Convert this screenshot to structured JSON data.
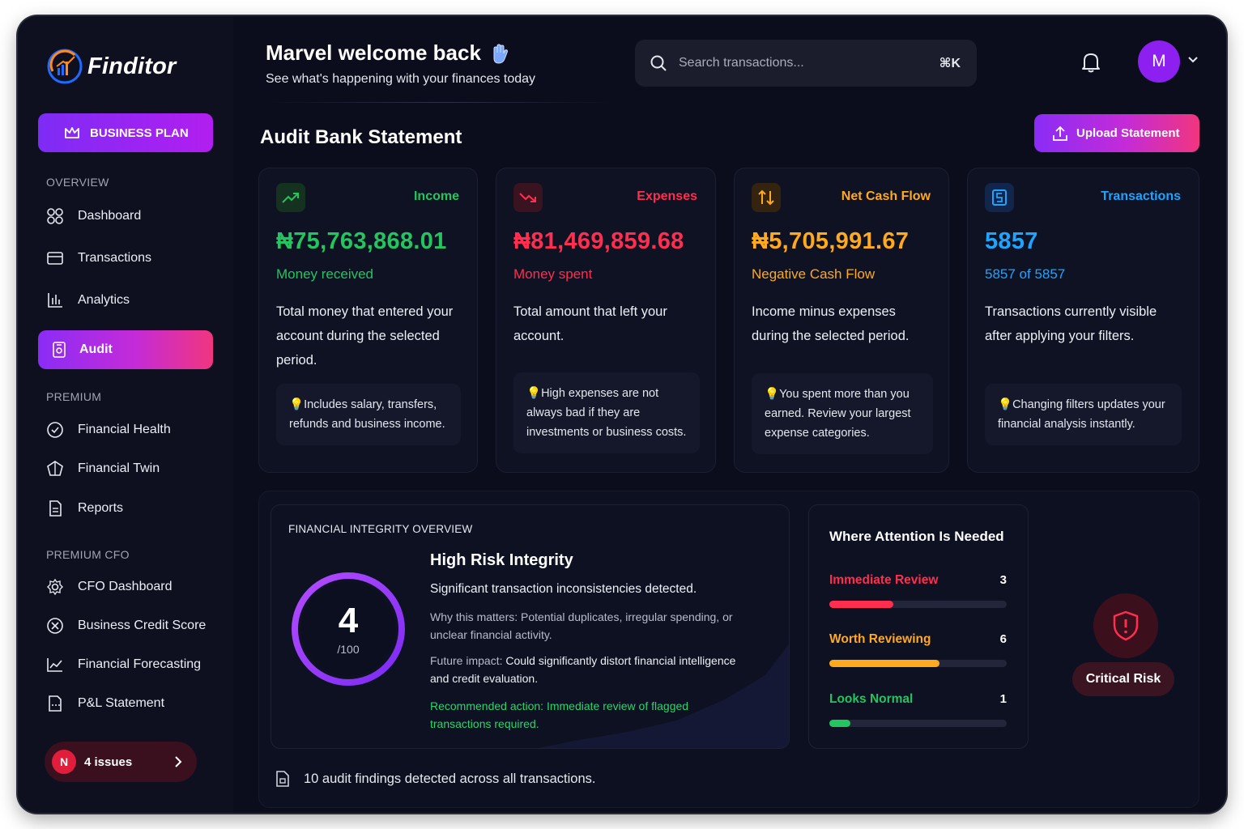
{
  "app": {
    "name": "Finditor"
  },
  "sidebar": {
    "plan_label": "BUSINESS PLAN",
    "sections": {
      "overview": "OVERVIEW",
      "premium": "PREMIUM",
      "premium_cfo": "PREMIUM CFO"
    },
    "items": [
      {
        "label": "Dashboard",
        "icon": "grid-icon"
      },
      {
        "label": "Transactions",
        "icon": "card-icon"
      },
      {
        "label": "Analytics",
        "icon": "bar-chart-icon"
      },
      {
        "label": "Audit",
        "icon": "audit-icon",
        "active": true
      },
      {
        "label": "Financial Health",
        "icon": "check-circle-icon"
      },
      {
        "label": "Financial Twin",
        "icon": "twin-icon"
      },
      {
        "label": "Reports",
        "icon": "report-icon"
      },
      {
        "label": "CFO Dashboard",
        "icon": "gear-icon"
      },
      {
        "label": "Business Credit Score",
        "icon": "credit-icon"
      },
      {
        "label": "Financial Forecasting",
        "icon": "line-chart-icon"
      },
      {
        "label": "P&L Statement",
        "icon": "statement-icon"
      }
    ],
    "issues": {
      "badge": "N",
      "label": "4 issues"
    }
  },
  "header": {
    "welcome": "Marvel welcome back",
    "subtitle": "See what's happening with your finances today",
    "search_placeholder": "Search transactions...",
    "shortcut": "⌘K",
    "avatar_initial": "M"
  },
  "page": {
    "title": "Audit Bank Statement",
    "upload_label": "Upload Statement"
  },
  "cards": [
    {
      "label": "Income",
      "value": "₦75,763,868.01",
      "sub": "Money received",
      "desc": "Total money that entered your account during the selected period.",
      "tip": "Includes salary, transfers, refunds and business income.",
      "color": "#22c55e",
      "icon": "trend-up-icon"
    },
    {
      "label": "Expenses",
      "value": "₦81,469,859.68",
      "sub": "Money spent",
      "desc": "Total amount that left your account.",
      "tip": "High expenses are not always bad if they are investments or business costs.",
      "color": "#ff2e4f",
      "icon": "trend-down-icon"
    },
    {
      "label": "Net Cash Flow",
      "value": "₦5,705,991.67",
      "sub": "Negative Cash Flow",
      "desc": "Income minus expenses during the selected period.",
      "tip": "You spent more than you earned. Review your largest expense categories.",
      "color": "#ffa91f",
      "icon": "arrows-updown-icon"
    },
    {
      "label": "Transactions",
      "value": "5857",
      "sub": "5857 of 5857",
      "desc": "Transactions currently visible after applying your filters.",
      "tip": "Changing filters updates your financial analysis instantly.",
      "color": "#1ea4ff",
      "icon": "document-icon"
    }
  ],
  "integrity": {
    "caption": "FINANCIAL INTEGRITY OVERVIEW",
    "score": "4",
    "max": "/100",
    "score_fraction": 0.04,
    "title": "High Risk Integrity",
    "lead": "Significant transaction inconsistencies detected.",
    "why_label": "Why this matters:",
    "why_text": "Potential duplicates, irregular spending, or unclear financial activity.",
    "impact_label": "Future impact:",
    "impact_text": "Could significantly distort financial intelligence and credit evaluation.",
    "recommendation": "Recommended action: Immediate review of flagged transactions required."
  },
  "attention": {
    "title": "Where Attention Is Needed",
    "rows": [
      {
        "label": "Immediate Review",
        "count": "3",
        "fill": 0.36,
        "color": "#ff2e4f"
      },
      {
        "label": "Worth Reviewing",
        "count": "6",
        "fill": 0.62,
        "color": "#ffa91f"
      },
      {
        "label": "Looks Normal",
        "count": "1",
        "fill": 0.12,
        "color": "#22c55e"
      }
    ]
  },
  "risk": {
    "label": "Critical Risk"
  },
  "footer": {
    "findings": "10 audit findings detected across all transactions."
  }
}
